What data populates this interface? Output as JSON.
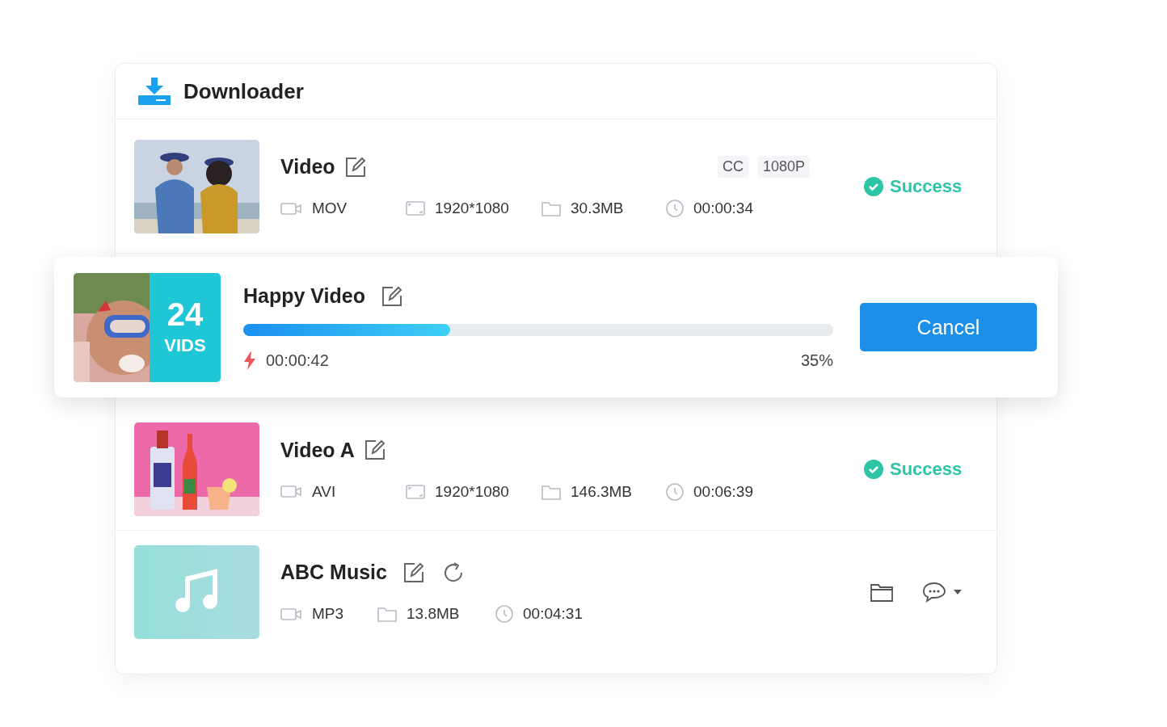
{
  "window": {
    "title": "Downloader"
  },
  "items": [
    {
      "kind": "done",
      "title": "Video",
      "thumbnail": {
        "kind": "picture"
      },
      "tags": [
        "CC",
        "1080P"
      ],
      "meta": [
        {
          "kind": "format",
          "text": "MOV"
        },
        {
          "kind": "resolution",
          "text": "1920*1080"
        },
        {
          "kind": "size",
          "text": "30.3MB"
        },
        {
          "kind": "duration",
          "text": "00:00:34"
        }
      ],
      "status": "Success"
    },
    {
      "kind": "downloading",
      "title": "Happy Video",
      "thumbnail": {
        "kind": "picture"
      },
      "count": "24",
      "count_label": "VIDS",
      "level": 0.35,
      "elapsed": "00:00:42",
      "percent": "35%",
      "button": "Cancel"
    },
    {
      "kind": "done",
      "title": "Video A",
      "thumbnail": {
        "kind": "picture"
      },
      "meta": [
        {
          "kind": "format",
          "text": "AVI"
        },
        {
          "kind": "resolution",
          "text": "1920*1080"
        },
        {
          "kind": "size",
          "text": "146.3MB"
        },
        {
          "kind": "duration",
          "text": "00:06:39"
        }
      ],
      "status": "Success"
    },
    {
      "kind": "audio",
      "title": "ABC Music",
      "thumbnail": {
        "kind": "music"
      },
      "meta": [
        {
          "kind": "format",
          "text": "MP3"
        },
        {
          "kind": "size",
          "text": "13.8MB"
        },
        {
          "kind": "duration",
          "text": "00:04:31"
        }
      ]
    }
  ]
}
